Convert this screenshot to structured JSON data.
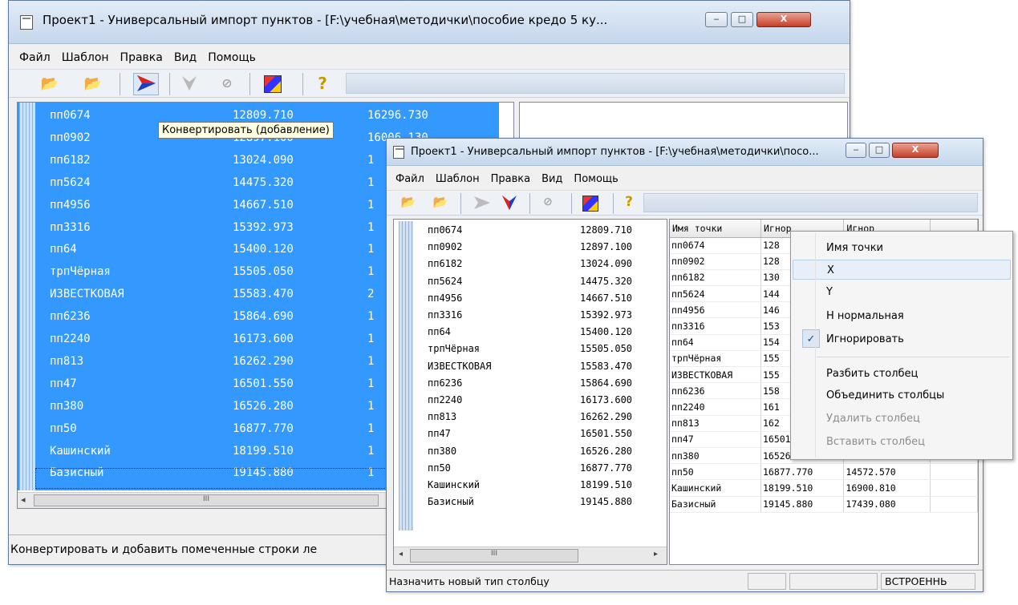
{
  "win1": {
    "title": "Проект1 - Универсальный импорт пунктов - [F:\\учебная\\методички\\пособие кредо 5 ку...",
    "ctrl_min": "‒",
    "ctrl_max": "□",
    "ctrl_close": "X",
    "menu": [
      "Файл",
      "Шаблон",
      "Правка",
      "Вид",
      "Помощь"
    ],
    "tooltip": "Конвертировать (добавление)",
    "rows": [
      {
        "name": "пп0674",
        "x": "12809.710",
        "y": "16296.730"
      },
      {
        "name": "пп0902",
        "x": "12897.100",
        "y": "16006.130"
      },
      {
        "name": "пп6182",
        "x": "13024.090",
        "y": "1"
      },
      {
        "name": "пп5624",
        "x": "14475.320",
        "y": "1"
      },
      {
        "name": "пп4956",
        "x": "14667.510",
        "y": "1"
      },
      {
        "name": "пп3316",
        "x": "15392.973",
        "y": "1"
      },
      {
        "name": "пп64",
        "x": "15400.120",
        "y": "1"
      },
      {
        "name": "трпЧёрная",
        "x": "15505.050",
        "y": "1"
      },
      {
        "name": "ИЗВЕСТКОВАЯ",
        "x": "15583.470",
        "y": "2"
      },
      {
        "name": "пп6236",
        "x": "15864.690",
        "y": "1"
      },
      {
        "name": "пп2240",
        "x": "16173.600",
        "y": "1"
      },
      {
        "name": "пп813",
        "x": "16262.290",
        "y": "1"
      },
      {
        "name": "пп47",
        "x": "16501.550",
        "y": "1"
      },
      {
        "name": "пп380",
        "x": "16526.280",
        "y": "1"
      },
      {
        "name": "пп50",
        "x": "16877.770",
        "y": "1"
      },
      {
        "name": "Кашинский",
        "x": "18199.510",
        "y": "1"
      },
      {
        "name": "Базисный",
        "x": "19145.880",
        "y": "1"
      }
    ],
    "scroll_thumb": "III",
    "status": "Конвертировать и добавить помеченные строки ле"
  },
  "win2": {
    "title": "Проект1 - Универсальный импорт пунктов - [F:\\учебная\\методички\\посо...",
    "ctrl_min": "‒",
    "ctrl_max": "□",
    "ctrl_close": "X",
    "menu": [
      "Файл",
      "Шаблон",
      "Правка",
      "Вид",
      "Помощь"
    ],
    "left_rows": [
      {
        "name": "пп0674",
        "x": "12809.710"
      },
      {
        "name": "пп0902",
        "x": "12897.100"
      },
      {
        "name": "пп6182",
        "x": "13024.090"
      },
      {
        "name": "пп5624",
        "x": "14475.320"
      },
      {
        "name": "пп4956",
        "x": "14667.510"
      },
      {
        "name": "пп3316",
        "x": "15392.973"
      },
      {
        "name": "пп64",
        "x": "15400.120"
      },
      {
        "name": "трпЧёрная",
        "x": "15505.050"
      },
      {
        "name": "ИЗВЕСТКОВАЯ",
        "x": "15583.470"
      },
      {
        "name": "пп6236",
        "x": "15864.690"
      },
      {
        "name": "пп2240",
        "x": "16173.600"
      },
      {
        "name": "пп813",
        "x": "16262.290"
      },
      {
        "name": "пп47",
        "x": "16501.550"
      },
      {
        "name": "пп380",
        "x": "16526.280"
      },
      {
        "name": "пп50",
        "x": "16877.770"
      },
      {
        "name": "Кашинский",
        "x": "18199.510"
      },
      {
        "name": "Базисный",
        "x": "19145.880"
      }
    ],
    "scroll_thumb": "III",
    "grid_headers": [
      "Имя точки",
      "Игнор",
      "Игнор"
    ],
    "grid_rows": [
      [
        "пп0674",
        "128",
        ""
      ],
      [
        "пп0902",
        "128",
        ""
      ],
      [
        "пп6182",
        "130",
        ""
      ],
      [
        "пп5624",
        "144",
        ""
      ],
      [
        "пп4956",
        "146",
        ""
      ],
      [
        "пп3316",
        "153",
        ""
      ],
      [
        "пп64",
        "154",
        ""
      ],
      [
        "трпЧёрная",
        "155",
        ""
      ],
      [
        "ИЗВЕСТКОВАЯ",
        "155",
        ""
      ],
      [
        "пп6236",
        "158",
        ""
      ],
      [
        "пп2240",
        "161",
        ""
      ],
      [
        "пп813",
        "162",
        ""
      ],
      [
        "пп47",
        "16501.550",
        "14568.400"
      ],
      [
        "пп380",
        "16526.280",
        "13571.540"
      ],
      [
        "пп50",
        "16877.770",
        "14572.570"
      ],
      [
        "Кашинский",
        "18199.510",
        "16900.810"
      ],
      [
        "Базисный",
        "19145.880",
        "17439.080"
      ]
    ],
    "status_left": "Назначить новый тип столбцу",
    "status_right": "ВСТРОЕННЬ"
  },
  "context_menu": {
    "items": [
      {
        "label": "Имя точки",
        "enabled": true
      },
      {
        "label": "X",
        "enabled": true,
        "hover": true
      },
      {
        "label": "Y",
        "enabled": true
      },
      {
        "label": "Н нормальная",
        "enabled": true
      },
      {
        "label": "Игнорировать",
        "enabled": true,
        "checked": true
      },
      {
        "label": "Разбить столбец",
        "enabled": true
      },
      {
        "label": "Объединить столбцы",
        "enabled": true
      },
      {
        "label": "Удалить столбец",
        "enabled": false
      },
      {
        "label": "Вставить столбец",
        "enabled": false
      }
    ],
    "check_mark": "✓"
  },
  "colors": {
    "selection": "#3399ff",
    "disabled_text": "#8c8c8c"
  }
}
